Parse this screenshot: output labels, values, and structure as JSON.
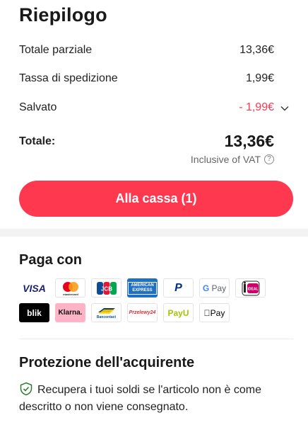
{
  "summary": {
    "title": "Riepilogo",
    "subtotal_label": "Totale parziale",
    "subtotal_value": "13,36€",
    "shipping_label": "Tassa di spedizione",
    "shipping_value": "1,99€",
    "saved_label": "Salvato",
    "saved_value": "- 1,99€",
    "total_label": "Totale:",
    "total_value": "13,36€",
    "vat_note": "Inclusive of VAT",
    "vat_help": "?",
    "checkout_label": "Alla cassa (1)"
  },
  "payment": {
    "title": "Paga con",
    "methods": {
      "visa": "VISA",
      "mastercard": "mastercard",
      "jcb": "JCB",
      "amex": "AMERICAN EXPRESS",
      "paypal": "P",
      "gpay": "Pay",
      "ideal": "iDEAL",
      "blik": "blik",
      "klarna": "Klarna.",
      "bancontact": "Bancontact",
      "przelewy": "Przelewy24",
      "payu": "PayU",
      "applepay": "Pay"
    }
  },
  "protection": {
    "title": "Protezione dell'acquirente",
    "text": "Recupera i tuoi soldi se l'articolo non è come descritto o non viene consegnato."
  },
  "colors": {
    "accent": "#fd384f",
    "text": "#191919",
    "muted": "#666666",
    "divider": "#f2f2f2"
  },
  "icons": {
    "saved_toggle": "chevron-down-icon",
    "vat_help": "question-circle-icon",
    "protection": "shield-check-icon"
  }
}
